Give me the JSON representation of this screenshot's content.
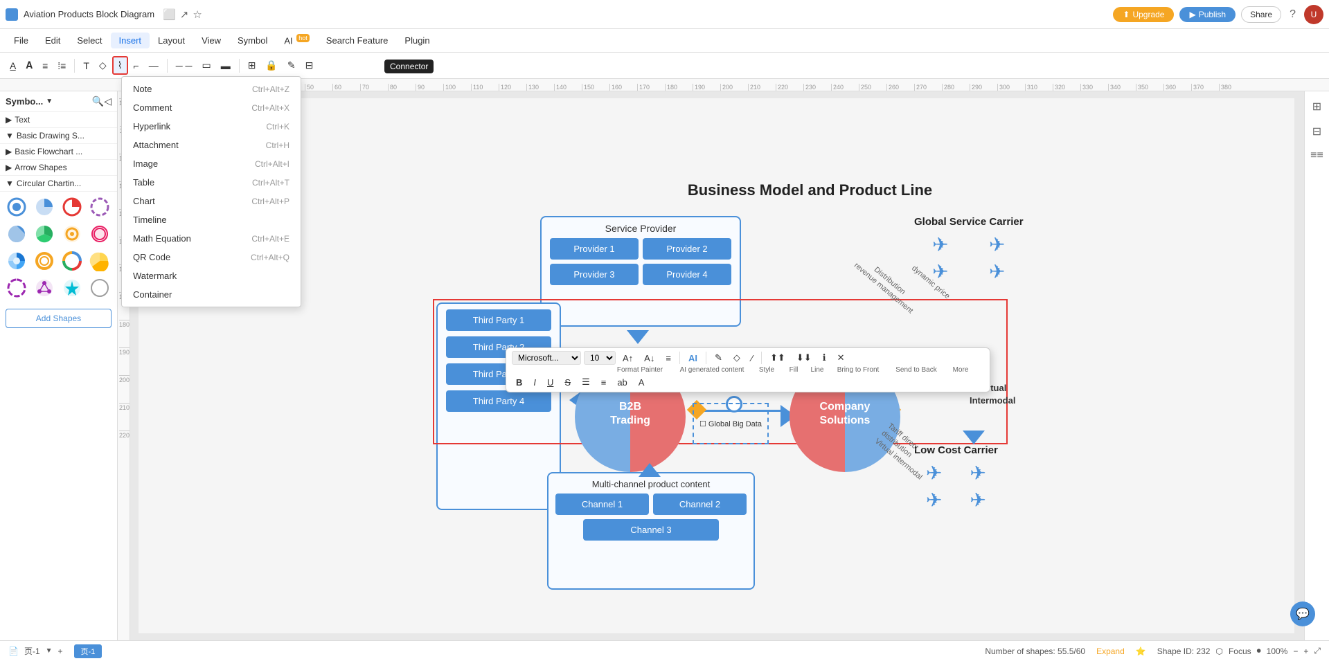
{
  "app": {
    "title": "Aviation Products Block Diagram",
    "tab_icons": [
      "⬜",
      "↗",
      "☆"
    ]
  },
  "topbar": {
    "upgrade_label": "Upgrade",
    "publish_label": "Publish",
    "share_label": "Share",
    "avatar_initials": "U"
  },
  "menubar": {
    "items": [
      {
        "label": "File",
        "shortcut": ""
      },
      {
        "label": "Edit",
        "shortcut": ""
      },
      {
        "label": "Select",
        "shortcut": ""
      },
      {
        "label": "Insert",
        "shortcut": "",
        "active": true
      },
      {
        "label": "Layout",
        "shortcut": ""
      },
      {
        "label": "View",
        "shortcut": ""
      },
      {
        "label": "Symbol",
        "shortcut": ""
      },
      {
        "label": "AI",
        "hot": true
      },
      {
        "label": "Search Feature",
        "shortcut": ""
      },
      {
        "label": "Plugin",
        "shortcut": ""
      }
    ]
  },
  "insert_menu": {
    "items": [
      {
        "label": "Note",
        "shortcut": "Ctrl+Alt+Z"
      },
      {
        "label": "Comment",
        "shortcut": "Ctrl+Alt+X"
      },
      {
        "label": "Hyperlink",
        "shortcut": "Ctrl+K"
      },
      {
        "label": "Attachment",
        "shortcut": "Ctrl+H"
      },
      {
        "label": "Image",
        "shortcut": "Ctrl+Alt+I"
      },
      {
        "label": "Table",
        "shortcut": "Ctrl+Alt+T"
      },
      {
        "label": "Chart",
        "shortcut": "Ctrl+Alt+P"
      },
      {
        "label": "Timeline",
        "shortcut": ""
      },
      {
        "label": "Math Equation",
        "shortcut": "Ctrl+Alt+E"
      },
      {
        "label": "QR Code",
        "shortcut": "Ctrl+Alt+Q"
      },
      {
        "label": "Watermark",
        "shortcut": ""
      },
      {
        "label": "Container",
        "shortcut": ""
      }
    ]
  },
  "toolbar": {
    "connector_tooltip": "Connector"
  },
  "sidebar": {
    "search_placeholder": "Search...",
    "symbol_label": "Symbo...",
    "categories": [
      {
        "label": "Text",
        "expanded": true
      },
      {
        "label": "Basic Drawing S...",
        "expanded": true
      },
      {
        "label": "Basic Flowchart ...",
        "expanded": false
      },
      {
        "label": "Arrow Shapes",
        "expanded": false
      },
      {
        "label": "Circular Chartin...",
        "expanded": true
      }
    ],
    "add_shapes": "Add Shapes"
  },
  "diagram": {
    "title": "Business Model and Product Line",
    "service_provider": {
      "label": "Service Provider",
      "providers": [
        "Provider 1",
        "Provider 2",
        "Provider 3",
        "Provider 4"
      ]
    },
    "third_party": {
      "parties": [
        "Third Party 1",
        "Third Party 2",
        "Third Party 3",
        "Third Party 4"
      ]
    },
    "b2b": {
      "label": "B2B\nTrading"
    },
    "company": {
      "label": "Company\nSolutions"
    },
    "global_big_data": {
      "label": "Global Big Data"
    },
    "multichannel": {
      "label": "Multi-channel product content",
      "channels": [
        "Channel 1",
        "Channel 2",
        "Channel 3"
      ]
    },
    "global_service_carrier": {
      "label": "Global Service\nCarrier"
    },
    "low_cost_carrier": {
      "label": "Low Cost\nCarrier"
    },
    "annotations": {
      "dist_rev": "Distribution\nrevenue management",
      "tariff": "Tariff direct\ndistribution\nVirtual intermodal",
      "dynamic_price": "dynamic price"
    }
  },
  "format_toolbar": {
    "font": "Microsoft...",
    "size": "10",
    "labels": {
      "bold": "B",
      "italic": "I",
      "underline": "U",
      "strikethrough": "S",
      "bullet": "☰",
      "list": "≡",
      "ab": "ab",
      "a": "A",
      "format_painter": "Format Painter",
      "ai_content": "AI generated content",
      "style": "Style",
      "fill": "Fill",
      "line": "Line",
      "bring_front": "Bring to Front",
      "send_back": "Send to Back",
      "more": "More"
    }
  },
  "statusbar": {
    "page_label": "页-1",
    "tab_label": "页-1",
    "shape_count": "Number of shapes: 55.5/60",
    "expand": "Expand",
    "shape_id": "Shape ID: 232",
    "focus": "Focus",
    "zoom": "100%"
  }
}
